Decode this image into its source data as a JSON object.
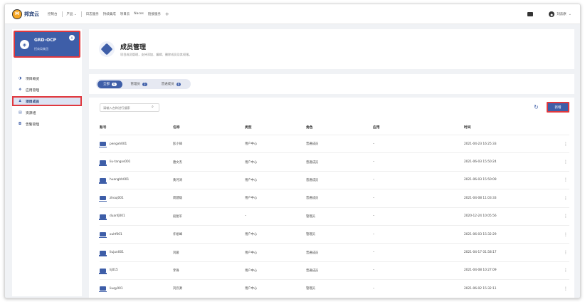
{
  "topbar": {
    "logo_mark": "M",
    "logo_text": "邦宾云",
    "nav": [
      "控制台",
      "产品 ⌄",
      "日志服务",
      "持续集成",
      "项目云",
      "Nacos",
      "链接服务"
    ],
    "plus": "+",
    "user_name": "刘云原",
    "caret": "⌄"
  },
  "sidebar": {
    "project": {
      "name": "GRD-OCP",
      "subtitle": "招商局集团",
      "icon": "cube-icon",
      "badge": "A"
    },
    "menu": [
      {
        "label": "项目概览",
        "icon": "◑"
      },
      {
        "label": "应用管理",
        "icon": "❖"
      },
      {
        "label": "项目成员",
        "icon": "♟",
        "active": true
      },
      {
        "label": "资源组",
        "icon": "▤"
      },
      {
        "label": "告警管理",
        "icon": "◘"
      }
    ]
  },
  "header": {
    "title": "成员管理",
    "description": "项目成员管理，支持添加、编辑、删除成员及其权限。"
  },
  "tabs": [
    {
      "label": "全部",
      "count": "9",
      "active": true
    },
    {
      "label": "管理员",
      "count": "3"
    },
    {
      "label": "普通成员",
      "count": "6"
    }
  ],
  "toolbar": {
    "search_placeholder": "请输入名称进行搜索",
    "add_label": "新增"
  },
  "table": {
    "columns": [
      "账号",
      "名称",
      "类型",
      "角色",
      "应用",
      "时间"
    ],
    "rows": [
      [
        "pengxh001",
        "彭小锋",
        "用户中心",
        "普通成员",
        "–",
        "2021-04-23 16:25:33"
      ],
      [
        "liu-tangxs001",
        "唐文杰",
        "用户中心",
        "普通成员",
        "–",
        "2021-06-03 15:50:24"
      ],
      [
        "huanghh001",
        "黄河涛",
        "用户中心",
        "普通成员",
        "–",
        "2021-06-03 15:50:09"
      ],
      [
        "zhouj001",
        "周健雄",
        "用户中心",
        "普通成员",
        "–",
        "2021-04-08 11:03:33"
      ],
      [
        "duanfj001",
        "段复军",
        "–",
        "管理员",
        "–",
        "2020-12-24 10:05:56"
      ],
      [
        "xuhf001",
        "许烩峰",
        "用户中心",
        "管理员",
        "–",
        "2021-06-03 15:32:29"
      ],
      [
        "liujun001",
        "刘骏",
        "用户中心",
        "普通成员",
        "–",
        "2021-04-17 01:58:17"
      ],
      [
        "lij015",
        "李锋",
        "用户中心",
        "普通成员",
        "–",
        "2021-04-08 10:27:09"
      ],
      [
        "liuqy001",
        "刘云源",
        "用户中心",
        "管理员",
        "–",
        "2021-06-02 15:32:11"
      ]
    ]
  },
  "colors": {
    "primary": "#3e5ea8",
    "highlight": "#e0383e"
  }
}
